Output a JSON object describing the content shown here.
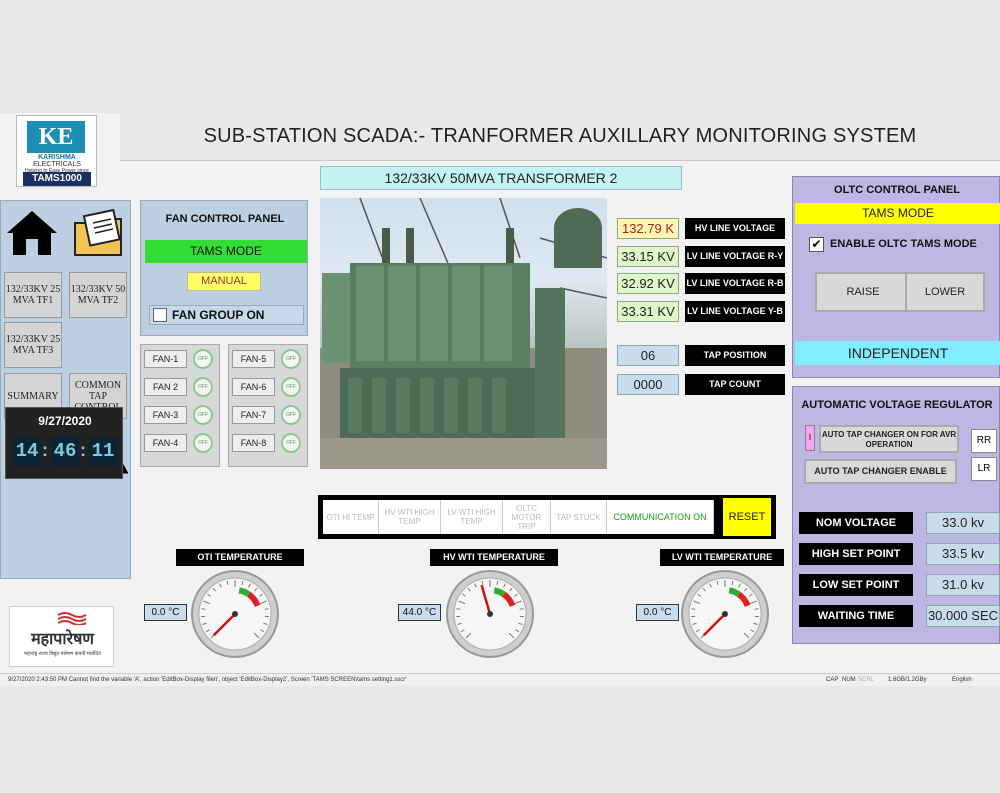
{
  "header": {
    "title": "SUB-STATION SCADA:- TRANFORMER  AUXILLARY MONITORING SYSTEM",
    "subtitle": "132/33KV 50MVA TRANSFORMER 2"
  },
  "logo": {
    "brand": "KE",
    "line1": "KARISHMA",
    "line2": "ELECTRICALS",
    "tagline": "Helping to Ease Power since 1995",
    "product": "TAMS1000"
  },
  "nav": {
    "tf1": "132/33KV 25 MVA TF1",
    "tf2": "132/33KV 50 MVA TF2",
    "tf3": "132/33KV 25 MVA TF3",
    "summary": "SUMMARY",
    "common_tap": "COMMON TAP CONTROL"
  },
  "clock": {
    "date": "9/27/2020",
    "hh": "14",
    "mm": "46",
    "ss": "11"
  },
  "fan_panel": {
    "title": "FAN CONTROL PANEL",
    "mode": "TAMS MODE",
    "manual": "MANUAL",
    "group_on": "FAN GROUP ON",
    "fans_left": [
      {
        "name": "FAN-1",
        "state": "OFF"
      },
      {
        "name": "FAN 2",
        "state": "OFF"
      },
      {
        "name": "FAN-3",
        "state": "OFF"
      },
      {
        "name": "FAN-4",
        "state": "OFF"
      }
    ],
    "fans_right": [
      {
        "name": "FAN-5",
        "state": "OFF"
      },
      {
        "name": "FAN-6",
        "state": "OFF"
      },
      {
        "name": "FAN-7",
        "state": "OFF"
      },
      {
        "name": "FAN-8",
        "state": "OFF"
      }
    ]
  },
  "voltages": [
    {
      "value": "132.79 K",
      "label": "HV LINE VOLTAGE"
    },
    {
      "value": "33.15 KV",
      "label": "LV LINE VOLTAGE R-Y"
    },
    {
      "value": "32.92 KV",
      "label": "LV LINE VOLTAGE R-B"
    },
    {
      "value": "33.31 KV",
      "label": "LV LINE VOLTAGE Y-B"
    }
  ],
  "tap": {
    "position_value": "06",
    "position_label": "TAP POSITION",
    "count_value": "0000",
    "count_label": "TAP COUNT"
  },
  "alarms": {
    "oti": "OTI HI TEMP",
    "hv_wti": "HV WTI HIGH TEMP",
    "lv_wti": "LV WTI HIGH TEMP",
    "oltc": "OLTC MOTOR TRIP",
    "tap_stuck": "TAP STUCK",
    "comm": "COMMUNICATION ON",
    "reset": "RESET"
  },
  "gauges": [
    {
      "label": "OTI TEMPERATURE",
      "value": "0.0 °C",
      "reading": 0
    },
    {
      "label": "HV WTI TEMPERATURE",
      "value": "44.0 °C",
      "reading": 44
    },
    {
      "label": "LV WTI TEMPERATURE",
      "value": "0.0 °C",
      "reading": 0
    }
  ],
  "oltc": {
    "title": "OLTC CONTROL PANEL",
    "mode": "TAMS MODE",
    "enable": "ENABLE OLTC TAMS MODE",
    "raise": "RAISE",
    "lower": "LOWER",
    "independent": "INDEPENDENT"
  },
  "avr": {
    "title": "AUTOMATIC VOLTAGE REGULATOR",
    "indicator": "I",
    "auto_avr": "AUTO TAP CHANGER ON FOR AVR OPERATION",
    "rr": "RR",
    "auto_enable": "AUTO TAP CHANGER ENABLE",
    "lr": "LR",
    "rows": [
      {
        "label": "NOM VOLTAGE",
        "value": "33.0 kv"
      },
      {
        "label": "HIGH SET POINT",
        "value": "33.5 kv"
      },
      {
        "label": "LOW SET POINT",
        "value": "31.0 kv"
      },
      {
        "label": "WAITING TIME",
        "value": "30.000 SEC"
      }
    ]
  },
  "mahatransco": {
    "name": "महापारेषण",
    "tagline": "महाराष्ट्र राज्य विद्युत पारेषण कंपनी मर्यादित"
  },
  "statusbar": {
    "message": "9/27/2020 2:43:50 PM Cannot find the variable 'A', action 'EditBox-Display filen', object 'EditBox-Display2', Screen 'TAMS SCREEN\\tams setting1.sscr'",
    "cap": "CAP",
    "num": "NUM",
    "scrl": "SCRL",
    "mem": "1.6GB/1.2GBy",
    "lang": "English"
  },
  "colors": {
    "green": "#33dd33",
    "yellow": "#ffff00",
    "panel_blue": "#bcd0e2",
    "panel_purple": "#bfb7e3",
    "cyan": "#80eeff"
  }
}
